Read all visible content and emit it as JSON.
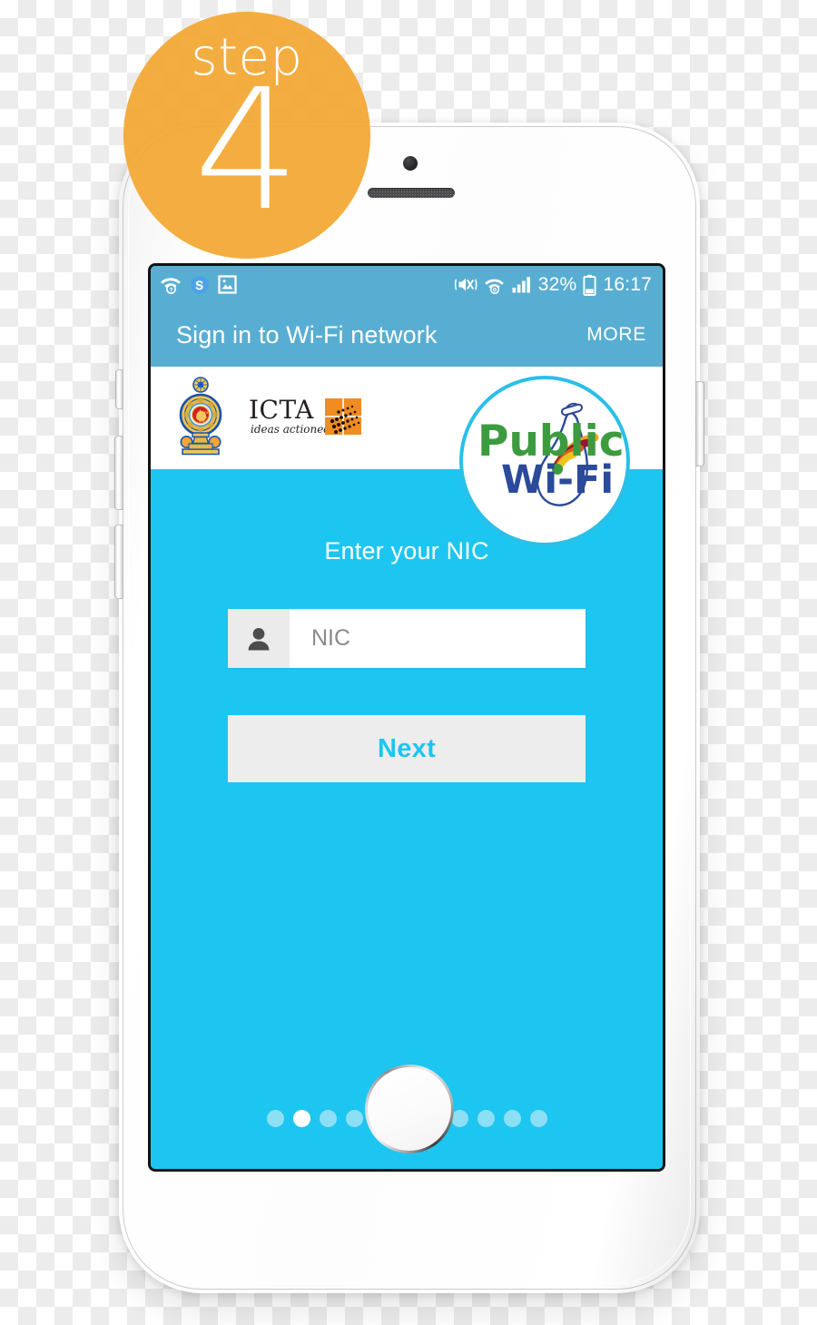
{
  "step_badge": {
    "word": "step",
    "number": "4",
    "color": "#f3a731"
  },
  "phone": {
    "device_name": "white-smartphone",
    "icons": {
      "front_camera": "camera-icon",
      "earpiece": "speaker-grille-icon",
      "home_button": "home-button-icon",
      "power_button": "power-button",
      "volume_up": "volume-up-button",
      "volume_down": "volume-down-button",
      "silent_switch": "silent-switch"
    }
  },
  "status_bar": {
    "background": "#58aed2",
    "left_icons": [
      {
        "name": "wifi-question-icon",
        "label": "Wi-Fi sign-in required"
      },
      {
        "name": "skype-icon",
        "label": "S"
      },
      {
        "name": "photo-icon",
        "label": "Screenshot captured"
      }
    ],
    "right_icons": [
      {
        "name": "mute-vibrate-icon",
        "label": "Sound off / vibrate"
      },
      {
        "name": "wifi-zero-icon",
        "label": "Wi-Fi no internet"
      },
      {
        "name": "signal-bars-icon",
        "label": "Mobile signal"
      }
    ],
    "battery_percent": "32%",
    "battery_icon": "battery-low-icon",
    "time": "16:17"
  },
  "title_bar": {
    "title": "Sign in to Wi-Fi network",
    "more_label": "MORE",
    "background": "#58aed2"
  },
  "logo_band": {
    "background": "#ffffff",
    "emblem": {
      "name": "sri-lanka-national-emblem",
      "alt": "Government of Sri Lanka emblem"
    },
    "icta_logo": {
      "name": "icta-logo",
      "wordmark": "ICTA",
      "tagline": "ideas actioned",
      "accent_color": "#f08c22"
    },
    "public_wifi_badge": {
      "name": "public-wifi-logo",
      "line1": "Public",
      "line2": "Wi-Fi",
      "line1_color": "#3d9b3f",
      "line2_color": "#2b4a99",
      "ring_color": "#2bbfe8"
    }
  },
  "form": {
    "heading": "Enter your NIC",
    "nic_input": {
      "placeholder": "NIC",
      "value": "",
      "icon": "person-icon"
    },
    "next_button": {
      "label": "Next",
      "text_color": "#1cc6f0",
      "background": "#ededed"
    },
    "background": "#1cc6f0"
  },
  "pagination": {
    "total": 11,
    "active_index": 1,
    "active_color": "#ffffff",
    "inactive_color": "#8ddff5"
  }
}
